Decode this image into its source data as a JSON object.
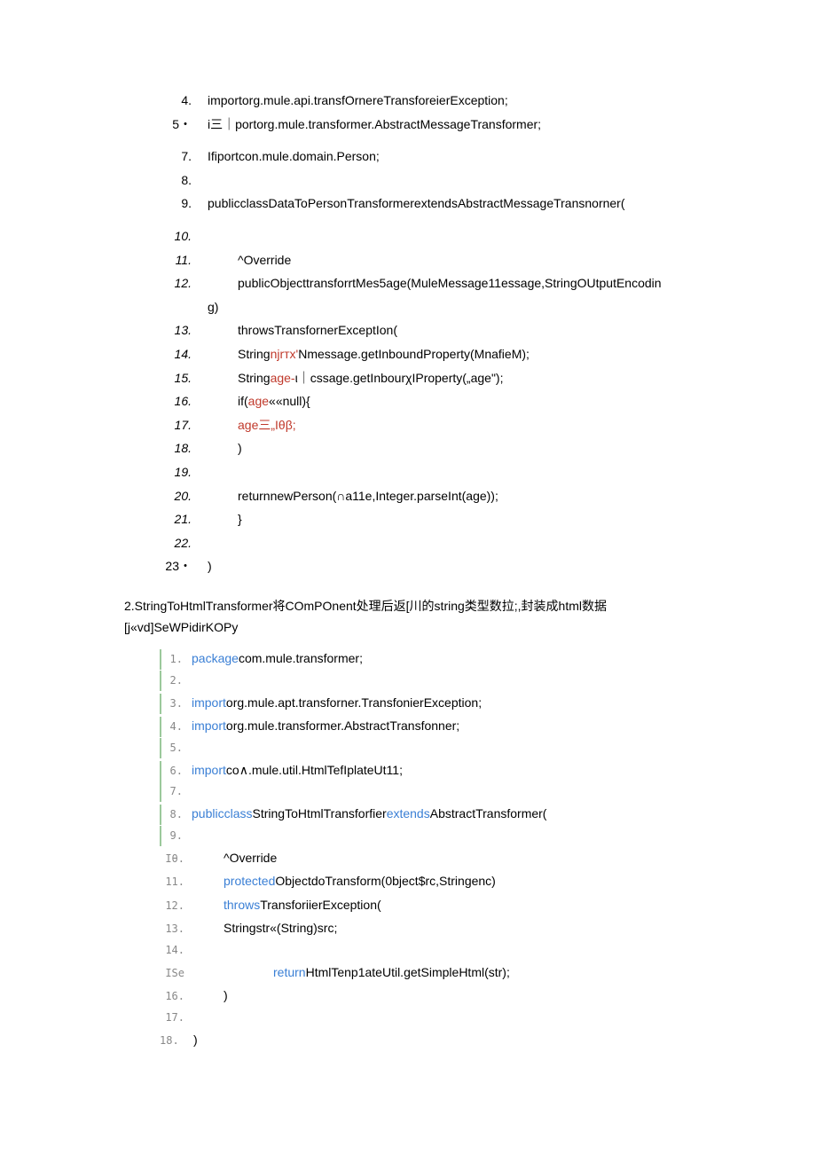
{
  "block1": {
    "l4": {
      "num": "4.",
      "text": "importorg.mule.api.transfOrnereTransforeierException;"
    },
    "l5": {
      "num": "5・",
      "text": "i三｜portorg.mule.transformer.AbstractMessageTransformer;"
    },
    "l7": {
      "num": "7.",
      "text": "Ifiportcon.mule.domain.Person;"
    },
    "l8": {
      "num": "8."
    },
    "l9": {
      "num": "9.",
      "text": "publicclassDataToPersonTransformerextendsAbstractMessageTransnorner("
    },
    "l10": {
      "num": "10."
    },
    "l11": {
      "num": "11.",
      "text": "^Override"
    },
    "l12": {
      "num": "12.",
      "text": "publicObjecttransforrtMes5age(MuleMessage11essage,StringOUtputEncodin"
    },
    "l12b": {
      "text": "g)"
    },
    "l13": {
      "num": "13.",
      "text": "throwsTransfornerExceptIon("
    },
    "l14": {
      "num": "14.",
      "pre": "String",
      "red": "njrтx'",
      "post": "Nmessage.getInboundProperty(MnafieM);"
    },
    "l15": {
      "num": "15.",
      "pre": "String",
      "red": "age-",
      "mid": "ι｜cssage",
      "post": ".getInbourχIProperty(„age\");"
    },
    "l16": {
      "num": "16.",
      "pre": "if(",
      "red": "age",
      "post": "««null){"
    },
    "l17": {
      "num": "17.",
      "red": "age三„Iθβ;"
    },
    "l18": {
      "num": "18.",
      "text": ")"
    },
    "l19": {
      "num": "19."
    },
    "l20": {
      "num": "20.",
      "text": "returnnewPerson(∩a11e,Integer.parseInt(age));"
    },
    "l21": {
      "num": "21.",
      "text": "}"
    },
    "l22": {
      "num": "22."
    },
    "l23": {
      "num": "23・",
      "text": ")"
    }
  },
  "section": {
    "line1": "2.StringToHtmlTransformer将COmPOnent处理后返[川的string类型数拉;,封装成html数据",
    "line2": "[j«vd]SeWPidirKOPy"
  },
  "block2": {
    "l1": {
      "num": "1.",
      "kw": "package",
      "text": "com.mule.transformer;"
    },
    "l2": {
      "num": "2."
    },
    "l3": {
      "num": "3.",
      "kw": "import",
      "text": "org.mule.apt.transforner.TransfonierException;"
    },
    "l4": {
      "num": "4.",
      "kw": "import",
      "text": "org.mule.transformer.AbstractTransfonner;"
    },
    "l5": {
      "num": "5."
    },
    "l6": {
      "num": "6.",
      "kw": "import",
      "text": "co∧.mule.util.HtmlTefIplateUt11;"
    },
    "l7": {
      "num": "7."
    },
    "l8": {
      "num": "8.",
      "kw1": "public",
      "kw2": "class",
      "mid": "StringToHtmlTransforfier",
      "kw3": "extends",
      "post": "AbstractTransformer("
    },
    "l9": {
      "num": "9."
    },
    "l10": {
      "num": "Iθ.",
      "text": "^Override"
    },
    "l11": {
      "num": "11.",
      "kw": "protected",
      "text": "ObjectdoTransform(0bject$rc,Stringenc)"
    },
    "l12": {
      "num": "12.",
      "kw": "throws",
      "text": "TransforiierException("
    },
    "l13": {
      "num": "13.",
      "text": "Stringstr«(String)src;"
    },
    "l14": {
      "num": "14."
    },
    "l15": {
      "num": "ISe",
      "kw": "return",
      "text": "HtmlTenp1ateUtil.getSimpleHtml(str);"
    },
    "l16": {
      "num": "16.",
      "text": ")"
    },
    "l17": {
      "num": "17."
    },
    "l18": {
      "num": "18.",
      "text": ")"
    }
  }
}
